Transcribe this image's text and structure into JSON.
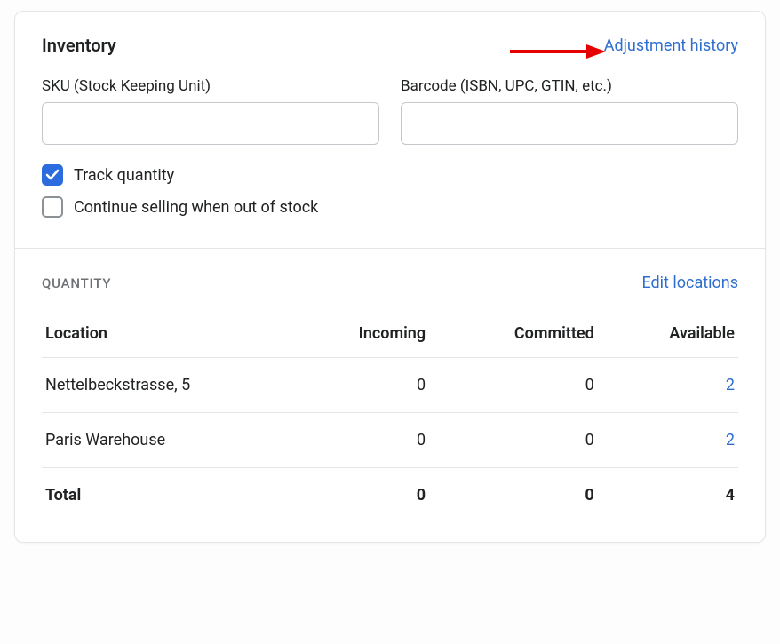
{
  "header": {
    "title": "Inventory",
    "adjustment_history_link": "Adjustment history"
  },
  "fields": {
    "sku_label": "SKU (Stock Keeping Unit)",
    "sku_value": "",
    "barcode_label": "Barcode (ISBN, UPC, GTIN, etc.)",
    "barcode_value": ""
  },
  "checkboxes": {
    "track_quantity": {
      "label": "Track quantity",
      "checked": true
    },
    "continue_selling": {
      "label": "Continue selling when out of stock",
      "checked": false
    }
  },
  "quantity": {
    "subhead": "QUANTITY",
    "edit_locations_link": "Edit locations",
    "columns": {
      "location": "Location",
      "incoming": "Incoming",
      "committed": "Committed",
      "available": "Available"
    },
    "rows": [
      {
        "location": "Nettelbeckstrasse, 5",
        "incoming": "0",
        "committed": "0",
        "available": "2"
      },
      {
        "location": "Paris Warehouse",
        "incoming": "0",
        "committed": "0",
        "available": "2"
      }
    ],
    "total": {
      "label": "Total",
      "incoming": "0",
      "committed": "0",
      "available": "4"
    }
  }
}
